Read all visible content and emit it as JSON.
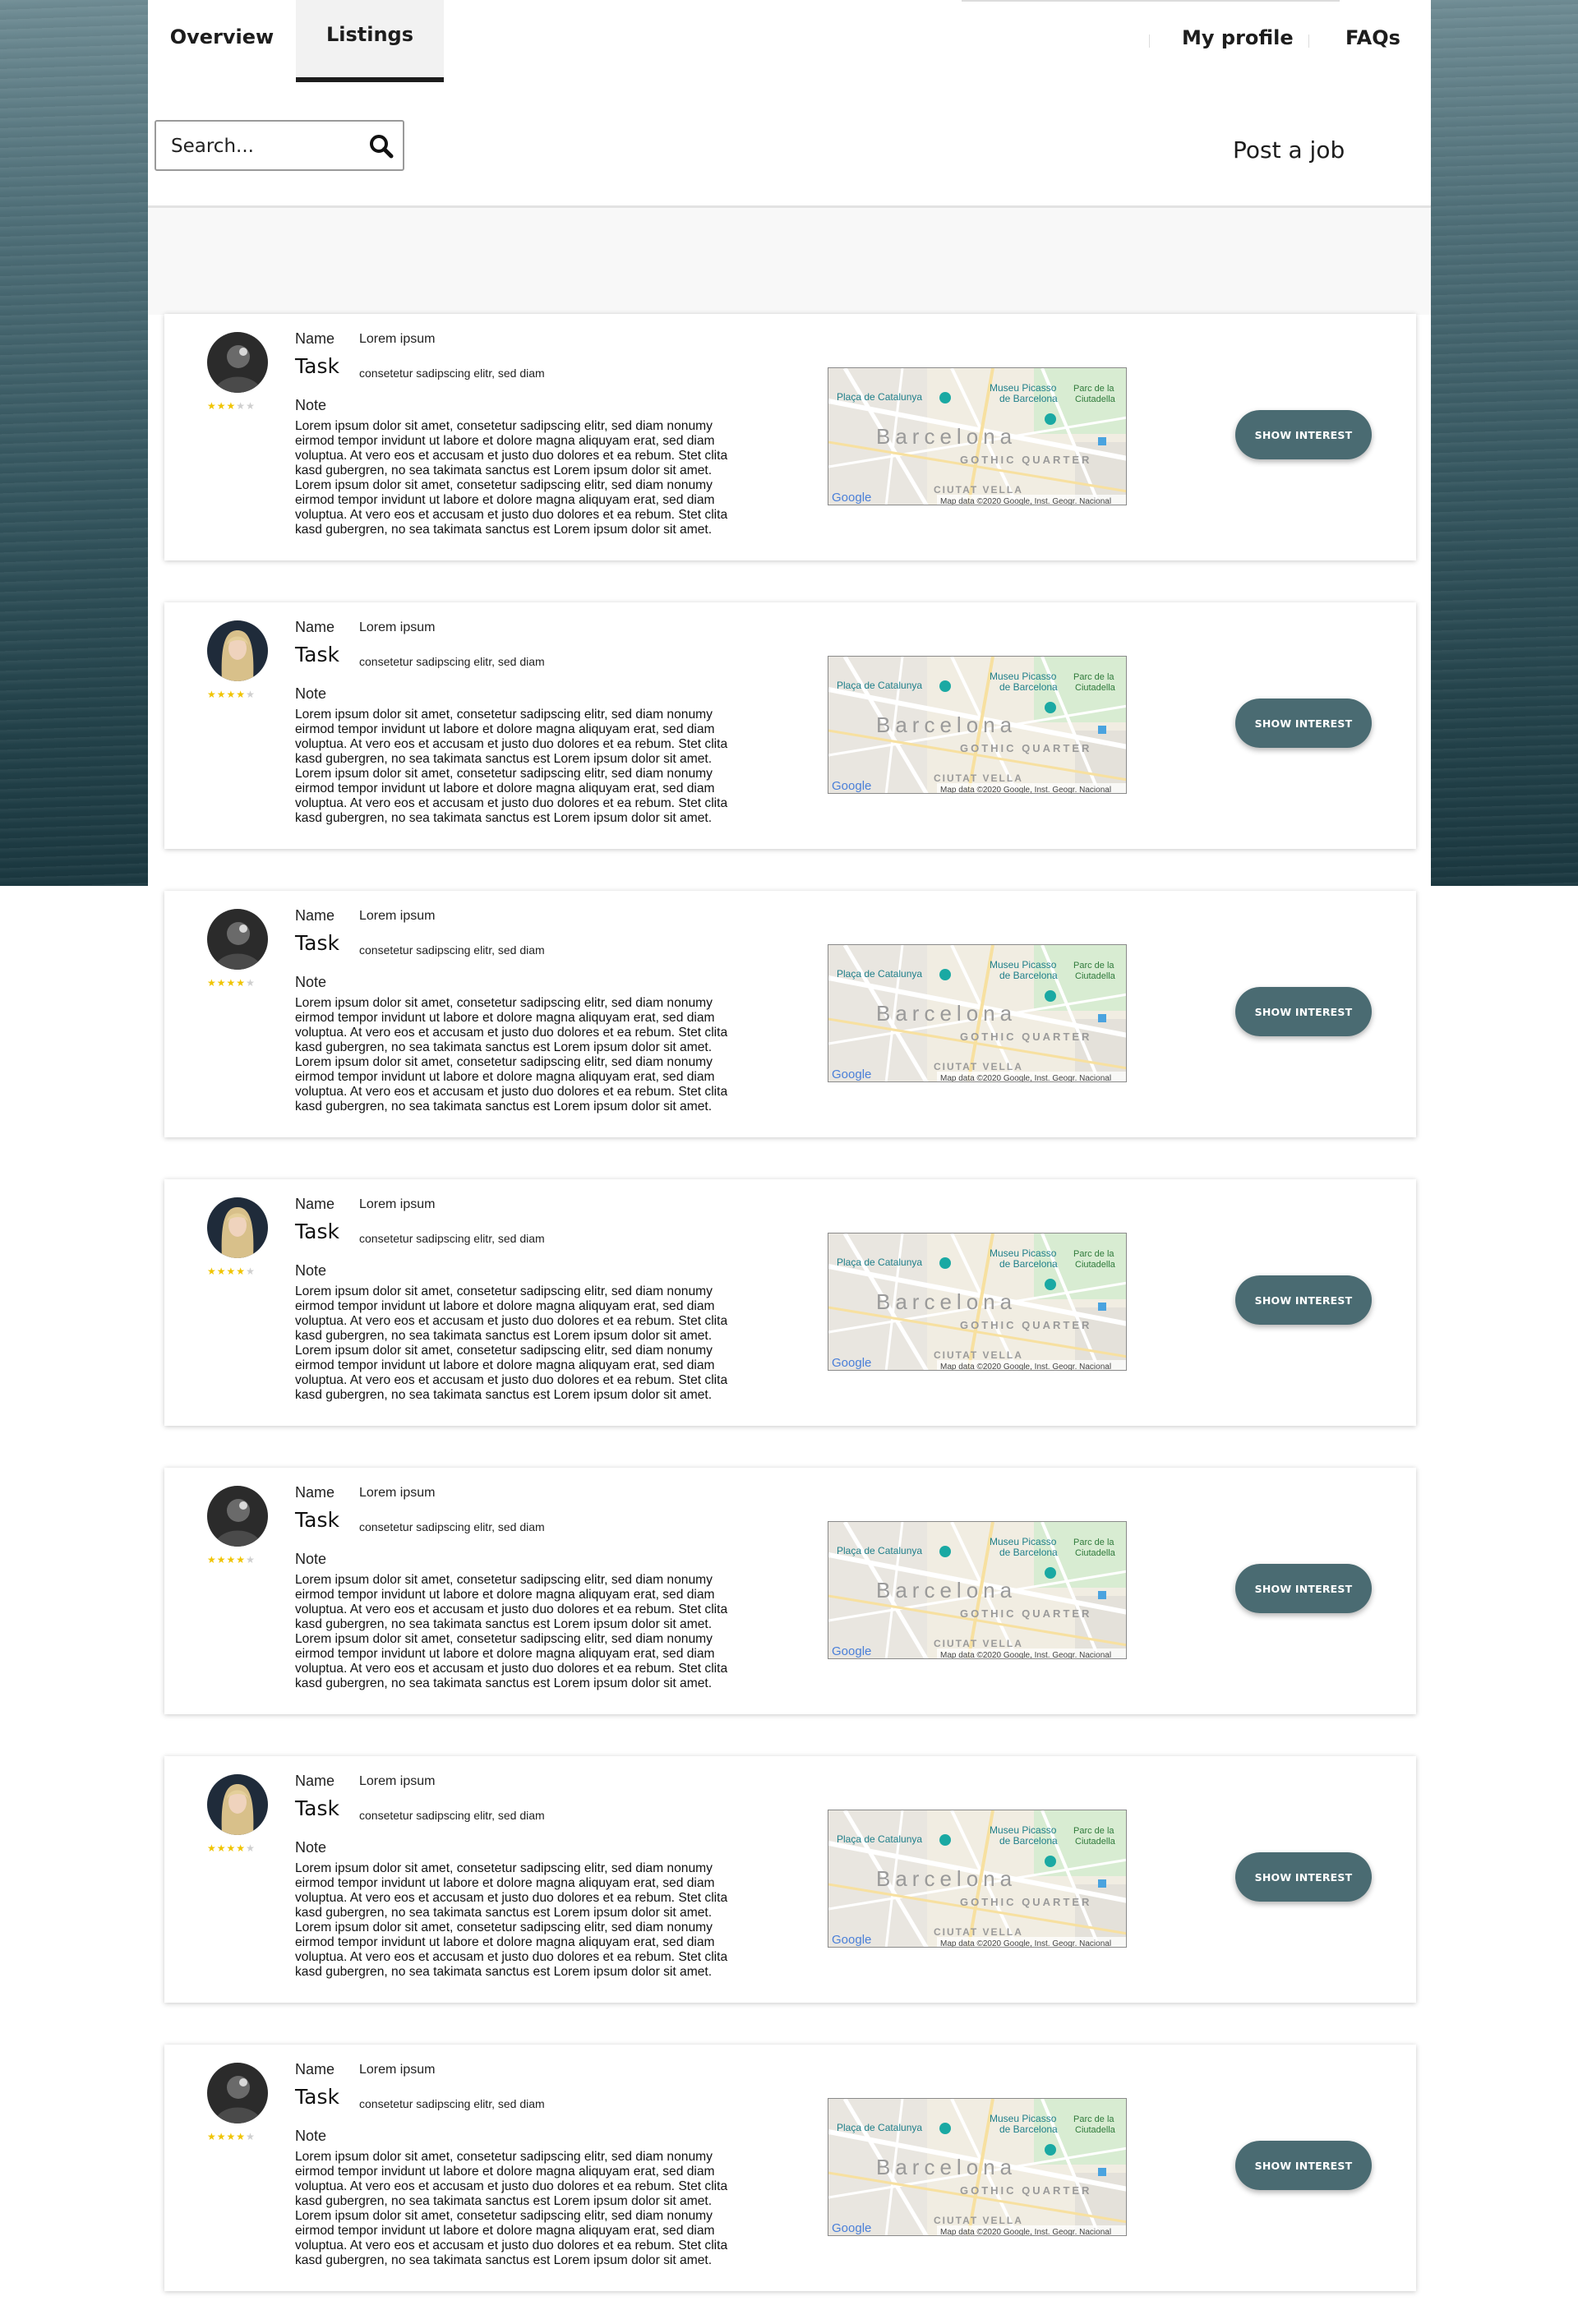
{
  "nav": {
    "tabs": [
      {
        "label": "Overview",
        "active": false
      },
      {
        "label": "Listings",
        "active": true
      }
    ],
    "links": {
      "profile": "My profile",
      "faqs": "FAQs"
    }
  },
  "search": {
    "placeholder": "Search..."
  },
  "post_job": "Post a job",
  "map": {
    "place_labels": {
      "plaza": "Plaça de Catalunya",
      "museum_line1": "Museu Picasso",
      "museum_line2": "de Barcelona",
      "park_line1": "Parc de la",
      "park_line2": "Ciutadella",
      "city": "Barcelona",
      "quarter": "GOTHIC QUARTER",
      "district": "CIUTAT VELLA",
      "provider": "Google",
      "attribution": "Map data ©2020 Google, Inst. Geogr. Nacional"
    }
  },
  "colors": {
    "button": "#4a6b72",
    "star_on": "#f0c400",
    "star_off": "#cfcfcf"
  },
  "listings": [
    {
      "avatar": "dark-avatar",
      "rating": 3,
      "name_label": "Name",
      "name": "Lorem ipsum",
      "task_label": "Task",
      "task": "consetetur sadipscing elitr, sed diam",
      "note_label": "Note",
      "note": "Lorem ipsum dolor sit amet, consetetur sadipscing elitr, sed diam nonumy eirmod tempor invidunt ut labore et dolore magna aliquyam erat, sed diam voluptua. At vero eos et accusam et justo duo dolores et ea rebum. Stet clita kasd gubergren, no sea takimata sanctus est Lorem ipsum dolor sit amet. Lorem ipsum dolor sit amet, consetetur sadipscing elitr, sed diam nonumy eirmod tempor invidunt ut labore et dolore magna aliquyam erat, sed diam voluptua. At vero eos et accusam et justo duo dolores et ea rebum. Stet clita kasd gubergren, no sea takimata sanctus est Lorem ipsum dolor sit amet.",
      "button": "Show interest"
    },
    {
      "avatar": "blonde-avatar",
      "rating": 4,
      "name_label": "Name",
      "name": "Lorem ipsum",
      "task_label": "Task",
      "task": "consetetur sadipscing elitr, sed diam",
      "note_label": "Note",
      "note": "Lorem ipsum dolor sit amet, consetetur sadipscing elitr, sed diam nonumy eirmod tempor invidunt ut labore et dolore magna aliquyam erat, sed diam voluptua. At vero eos et accusam et justo duo dolores et ea rebum. Stet clita kasd gubergren, no sea takimata sanctus est Lorem ipsum dolor sit amet. Lorem ipsum dolor sit amet, consetetur sadipscing elitr, sed diam nonumy eirmod tempor invidunt ut labore et dolore magna aliquyam erat, sed diam voluptua. At vero eos et accusam et justo duo dolores et ea rebum. Stet clita kasd gubergren, no sea takimata sanctus est Lorem ipsum dolor sit amet.",
      "button": "Show interest"
    },
    {
      "avatar": "dark-avatar",
      "rating": 4,
      "name_label": "Name",
      "name": "Lorem ipsum",
      "task_label": "Task",
      "task": "consetetur sadipscing elitr, sed diam",
      "note_label": "Note",
      "note": "Lorem ipsum dolor sit amet, consetetur sadipscing elitr, sed diam nonumy eirmod tempor invidunt ut labore et dolore magna aliquyam erat, sed diam voluptua. At vero eos et accusam et justo duo dolores et ea rebum. Stet clita kasd gubergren, no sea takimata sanctus est Lorem ipsum dolor sit amet. Lorem ipsum dolor sit amet, consetetur sadipscing elitr, sed diam nonumy eirmod tempor invidunt ut labore et dolore magna aliquyam erat, sed diam voluptua. At vero eos et accusam et justo duo dolores et ea rebum. Stet clita kasd gubergren, no sea takimata sanctus est Lorem ipsum dolor sit amet.",
      "button": "Show interest"
    },
    {
      "avatar": "blonde-avatar",
      "rating": 4,
      "name_label": "Name",
      "name": "Lorem ipsum",
      "task_label": "Task",
      "task": "consetetur sadipscing elitr, sed diam",
      "note_label": "Note",
      "note": "Lorem ipsum dolor sit amet, consetetur sadipscing elitr, sed diam nonumy eirmod tempor invidunt ut labore et dolore magna aliquyam erat, sed diam voluptua. At vero eos et accusam et justo duo dolores et ea rebum. Stet clita kasd gubergren, no sea takimata sanctus est Lorem ipsum dolor sit amet. Lorem ipsum dolor sit amet, consetetur sadipscing elitr, sed diam nonumy eirmod tempor invidunt ut labore et dolore magna aliquyam erat, sed diam voluptua. At vero eos et accusam et justo duo dolores et ea rebum. Stet clita kasd gubergren, no sea takimata sanctus est Lorem ipsum dolor sit amet.",
      "button": "Show interest"
    },
    {
      "avatar": "dark-avatar",
      "rating": 4,
      "name_label": "Name",
      "name": "Lorem ipsum",
      "task_label": "Task",
      "task": "consetetur sadipscing elitr, sed diam",
      "note_label": "Note",
      "note": "Lorem ipsum dolor sit amet, consetetur sadipscing elitr, sed diam nonumy eirmod tempor invidunt ut labore et dolore magna aliquyam erat, sed diam voluptua. At vero eos et accusam et justo duo dolores et ea rebum. Stet clita kasd gubergren, no sea takimata sanctus est Lorem ipsum dolor sit amet. Lorem ipsum dolor sit amet, consetetur sadipscing elitr, sed diam nonumy eirmod tempor invidunt ut labore et dolore magna aliquyam erat, sed diam voluptua. At vero eos et accusam et justo duo dolores et ea rebum. Stet clita kasd gubergren, no sea takimata sanctus est Lorem ipsum dolor sit amet.",
      "button": "Show interest"
    },
    {
      "avatar": "blonde-avatar",
      "rating": 4,
      "name_label": "Name",
      "name": "Lorem ipsum",
      "task_label": "Task",
      "task": "consetetur sadipscing elitr, sed diam",
      "note_label": "Note",
      "note": "Lorem ipsum dolor sit amet, consetetur sadipscing elitr, sed diam nonumy eirmod tempor invidunt ut labore et dolore magna aliquyam erat, sed diam voluptua. At vero eos et accusam et justo duo dolores et ea rebum. Stet clita kasd gubergren, no sea takimata sanctus est Lorem ipsum dolor sit amet. Lorem ipsum dolor sit amet, consetetur sadipscing elitr, sed diam nonumy eirmod tempor invidunt ut labore et dolore magna aliquyam erat, sed diam voluptua. At vero eos et accusam et justo duo dolores et ea rebum. Stet clita kasd gubergren, no sea takimata sanctus est Lorem ipsum dolor sit amet.",
      "button": "Show interest"
    },
    {
      "avatar": "dark-avatar",
      "rating": 4,
      "name_label": "Name",
      "name": "Lorem ipsum",
      "task_label": "Task",
      "task": "consetetur sadipscing elitr, sed diam",
      "note_label": "Note",
      "note": "Lorem ipsum dolor sit amet, consetetur sadipscing elitr, sed diam nonumy eirmod tempor invidunt ut labore et dolore magna aliquyam erat, sed diam voluptua. At vero eos et accusam et justo duo dolores et ea rebum. Stet clita kasd gubergren, no sea takimata sanctus est Lorem ipsum dolor sit amet. Lorem ipsum dolor sit amet, consetetur sadipscing elitr, sed diam nonumy eirmod tempor invidunt ut labore et dolore magna aliquyam erat, sed diam voluptua. At vero eos et accusam et justo duo dolores et ea rebum. Stet clita kasd gubergren, no sea takimata sanctus est Lorem ipsum dolor sit amet.",
      "button": "Show interest"
    }
  ]
}
